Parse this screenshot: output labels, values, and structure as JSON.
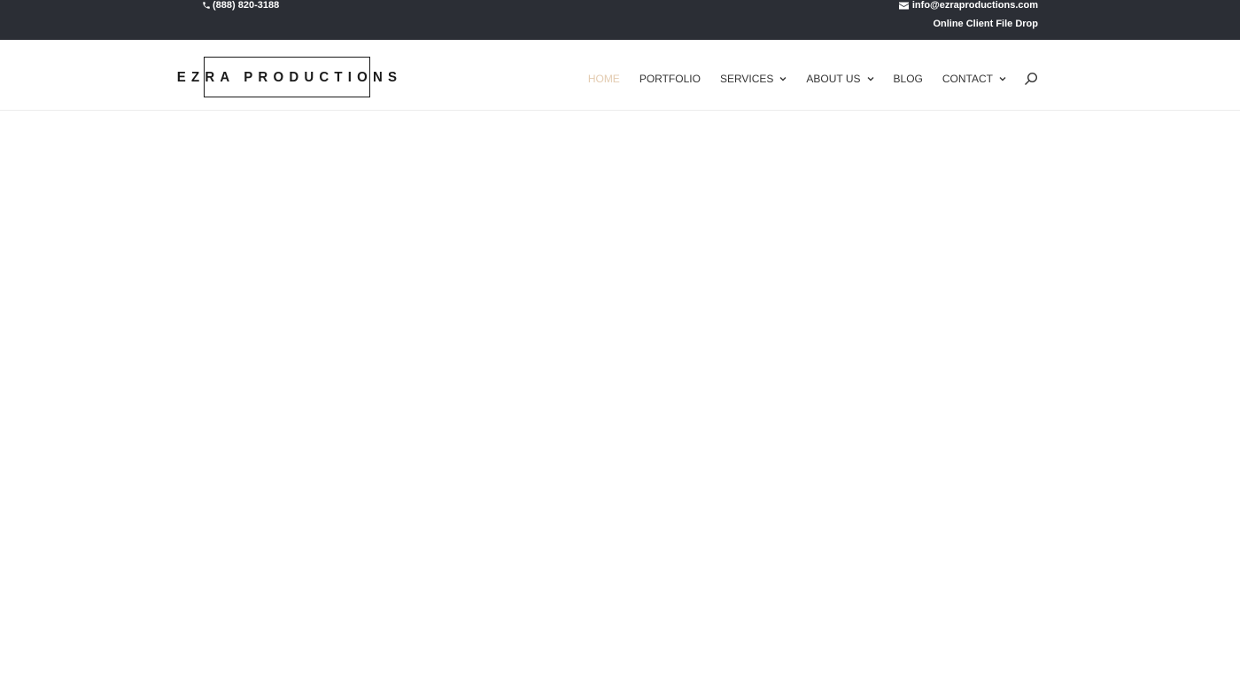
{
  "topbar": {
    "phone": "(888) 820-3188",
    "email": "info@ezraproductions.com",
    "file_drop": "Online Client File Drop"
  },
  "logo": {
    "text": "EZRA PRODUCTIONS"
  },
  "nav": {
    "items": [
      {
        "label": "HOME",
        "active": true,
        "dropdown": false
      },
      {
        "label": "PORTFOLIO",
        "active": false,
        "dropdown": false
      },
      {
        "label": "SERVICES",
        "active": false,
        "dropdown": true
      },
      {
        "label": "ABOUT US",
        "active": false,
        "dropdown": true
      },
      {
        "label": "BLOG",
        "active": false,
        "dropdown": false
      },
      {
        "label": "CONTACT",
        "active": false,
        "dropdown": true
      }
    ],
    "search_icon": "search-icon"
  },
  "colors": {
    "topbar_bg": "#2b2e35",
    "active_nav": "#e3cbb0",
    "nav_text": "#333333"
  }
}
